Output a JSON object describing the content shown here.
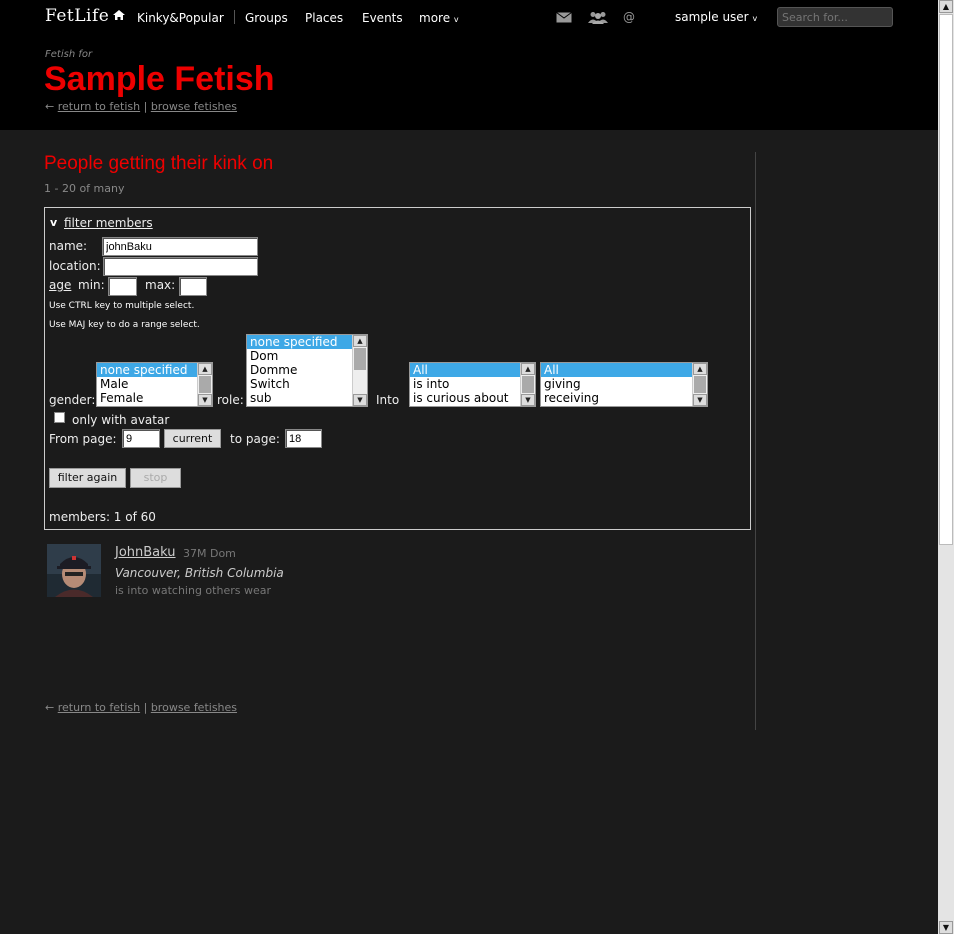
{
  "header": {
    "logo": "FetLife",
    "nav": [
      "Kinky&Popular",
      "Groups",
      "Places",
      "Events",
      "more"
    ],
    "more_arrow": "v",
    "user": "sample user",
    "user_arrow": "v",
    "search_placeholder": "Search for...",
    "icons": [
      "mail-icon",
      "friends-icon",
      "at-icon"
    ]
  },
  "page": {
    "fetish_for": "Fetish for",
    "title": "Sample Fetish",
    "return_link": "return to fetish",
    "browse_link": "browse fetishes",
    "section_title": "People getting their kink on",
    "count": "1 - 20 of many"
  },
  "filter": {
    "toggle": "v",
    "toggle_label": "filter members",
    "name_label": "name:",
    "name_value": "johnBaku",
    "location_label": "location:",
    "location_value": "",
    "age_label": "age",
    "min_label": "min:",
    "max_label": "max:",
    "hint_ctrl": "Use CTRL key to multiple select.",
    "hint_maj": "Use MAJ key to do a range select.",
    "gender_label": "gender:",
    "gender_options": [
      "none specified",
      "Male",
      "Female"
    ],
    "role_label": "role:",
    "role_options": [
      "none specified",
      "Dom",
      "Domme",
      "Switch",
      "sub"
    ],
    "into_label": "Into",
    "into_options": [
      "All",
      "is into",
      "is curious about"
    ],
    "mode_options": [
      "All",
      "giving",
      "receiving"
    ],
    "avatar_label": "only with avatar",
    "from_label": "From page:",
    "from_value": "9",
    "current_button": "current",
    "to_label": "to page:",
    "to_value": "18",
    "filter_again": "filter again",
    "stop": "stop",
    "members": "members: 1 of 60"
  },
  "member": {
    "name": "JohnBaku",
    "meta": "37M Dom",
    "location": "Vancouver, British Columbia",
    "into": "is into watching others wear"
  },
  "colors": {
    "accent": "#e00000",
    "selection": "#3ea8e6",
    "background": "#1b1b1b"
  }
}
